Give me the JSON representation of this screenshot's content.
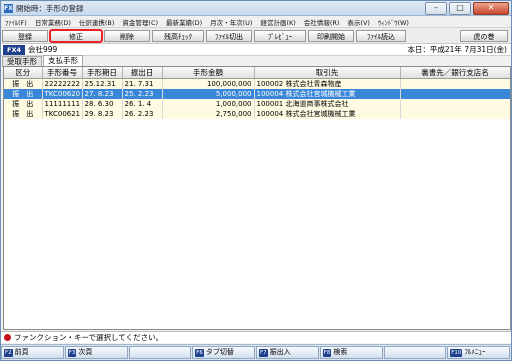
{
  "window": {
    "title": "開始時：手形の登録"
  },
  "menu": [
    "ﾌｧｲﾙ(F)",
    "日常業務(D)",
    "仕訳連携(B)",
    "資金管理(C)",
    "最新業績(D)",
    "月次・年次(U)",
    "経営計画(K)",
    "会社情報(R)",
    "表示(V)",
    "ｳｨﾝﾄﾞｳ(W)"
  ],
  "toolbar": {
    "buttons": [
      "登録",
      "修正",
      "削除",
      "残高ﾁｪｯｸ",
      "ﾌｧｲﾙ切出",
      "ﾌﾟﾚﾋﾞｭｰ",
      "印刷開始",
      "ﾌｧｲﾙ読込",
      "虎の巻"
    ]
  },
  "company": {
    "fx_tag": "FX4",
    "name": "会社999",
    "today": "本日：平成21年 7月31日(金)"
  },
  "tabs": [
    "受取手形",
    "支払手形"
  ],
  "table": {
    "headers": [
      "区分",
      "手形番号",
      "手形期日",
      "振出日",
      "手形金額",
      "取引先",
      "裏書先／銀行支店名"
    ],
    "rows": [
      {
        "kbn": "振　出",
        "no": "22222222",
        "due": "25.12.31",
        "issue": "21. 7.31",
        "amount": "100,000,000",
        "partner": "100002 株式会社青森物産",
        "bank": ""
      },
      {
        "kbn": "振　出",
        "no": "TKC00620",
        "due": "27. 8.23",
        "issue": "25. 2.23",
        "amount": "5,000,000",
        "partner": "100004 株式会社宮城機械工業",
        "bank": ""
      },
      {
        "kbn": "振　出",
        "no": "11111111",
        "due": "28. 6.30",
        "issue": "26. 1. 4",
        "amount": "1,000,000",
        "partner": "100001 北海道商事株式会社",
        "bank": ""
      },
      {
        "kbn": "振　出",
        "no": "TKC00621",
        "due": "29. 8.23",
        "issue": "26. 2.23",
        "amount": "2,750,000",
        "partner": "100004 株式会社宮城機械工業",
        "bank": ""
      }
    ]
  },
  "status": {
    "message": "ファンクション・キーで選択してください。"
  },
  "fkeys": [
    {
      "key": "F2",
      "label": "前頁"
    },
    {
      "key": "F3",
      "label": "次頁"
    },
    {
      "key": "",
      "label": ""
    },
    {
      "key": "F6",
      "label": "タブ切替"
    },
    {
      "key": "F7",
      "label": "振出入"
    },
    {
      "key": "F8",
      "label": "検索"
    },
    {
      "key": "",
      "label": ""
    },
    {
      "key": "F10",
      "label": "ﾌﾙﾒﾆｭｰ"
    }
  ],
  "colors": {
    "selection": "#3a86d8",
    "row_bg": "#fffbe3",
    "highlight_border": "#e8212b",
    "fx_tag": "#1f3f8f"
  }
}
